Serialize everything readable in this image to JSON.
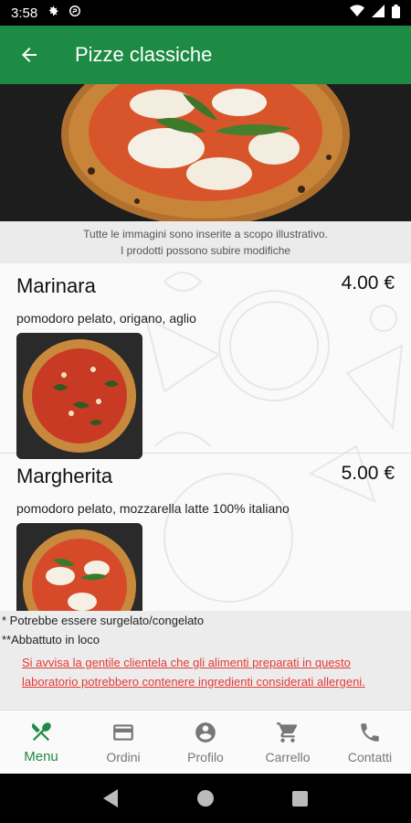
{
  "status_bar": {
    "time": "3:58"
  },
  "app_bar": {
    "title": "Pizze classiche"
  },
  "notice": {
    "line1": "Tutte le immagini sono inserite a scopo illustrativo.",
    "line2": "I prodotti possono subire modifiche"
  },
  "items": [
    {
      "name": "Marinara",
      "price": "4.00 €",
      "description": "pomodoro pelato, origano, aglio"
    },
    {
      "name": "Margherita",
      "price": "5.00 €",
      "description": "pomodoro pelato, mozzarella latte 100% italiano"
    }
  ],
  "footer": {
    "note1": "* Potrebbe essere surgelato/congelato",
    "note2": "**Abbattuto in loco",
    "warning": "Si avvisa la gentile clientela che gli alimenti preparati in questo laboratorio potrebbero contenere ingredienti considerati allergeni."
  },
  "bottom_nav": [
    {
      "label": "Menu",
      "icon": "fork-spoon-icon",
      "active": true
    },
    {
      "label": "Ordini",
      "icon": "card-icon",
      "active": false
    },
    {
      "label": "Profilo",
      "icon": "account-icon",
      "active": false
    },
    {
      "label": "Carrello",
      "icon": "cart-icon",
      "active": false
    },
    {
      "label": "Contatti",
      "icon": "phone-icon",
      "active": false
    }
  ],
  "colors": {
    "primary": "#1e8b44",
    "warning": "#e53935"
  }
}
